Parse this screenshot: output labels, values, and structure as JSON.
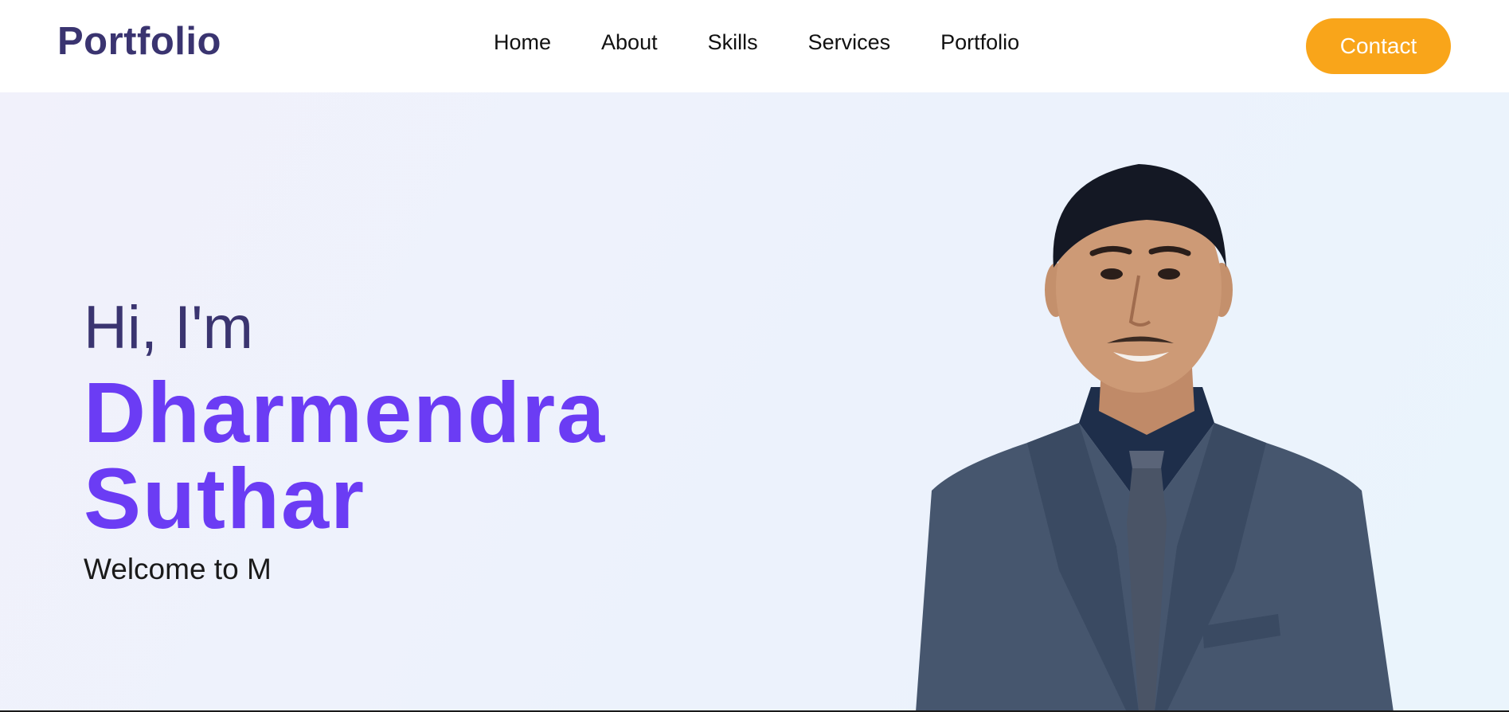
{
  "nav": {
    "brand": "Portfolio",
    "links": [
      "Home",
      "About",
      "Skills",
      "Services",
      "Portfolio"
    ],
    "contact_label": "Contact"
  },
  "hero": {
    "greeting": "Hi, I'm",
    "name_first": "Dharmendra",
    "name_last": "Suthar",
    "tagline": "Welcome to M"
  },
  "colors": {
    "brand": "#3a3470",
    "accent": "#6b3cf4",
    "button": "#f9a51a"
  }
}
